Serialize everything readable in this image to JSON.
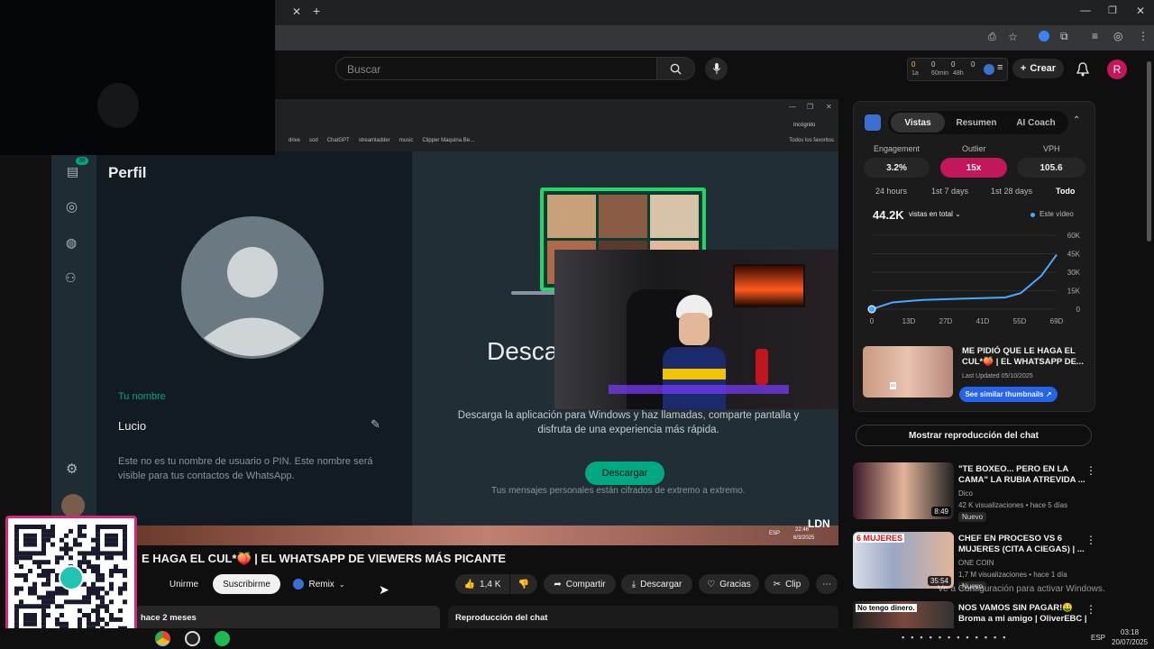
{
  "search": {
    "placeholder": "Buscar"
  },
  "header": {
    "create_label": "Crear",
    "avatar_letter": "R"
  },
  "counters": [
    "0",
    "0",
    "0",
    "0",
    "1a",
    "60min",
    "48h"
  ],
  "whatsapp": {
    "window_title": "Perfil",
    "badge": "38",
    "name_label": "Tu nombre",
    "name_value": "Lucio",
    "name_note": "Este no es tu nombre de usuario o PIN. Este nombre será visible para tus contactos de WhatsApp.",
    "main_title": "Descar",
    "main_desc": "Descarga la aplicación para Windows y haz llamadas, comparte pantalla y disfruta de una experiencia más rápida.",
    "download_label": "Descargar",
    "encrypted_note": "Tus mensajes personales están cifrados de extremo a extremo.",
    "inner_bookmarks": [
      "drive",
      "sod",
      "ChatGPT",
      "streamladder",
      "music",
      "Clipper Maquina Be...",
      "Todos los favoritos"
    ],
    "incognito": "Incógnito",
    "ldn": "LDN",
    "inner_clock": "22:46",
    "inner_date": "6/3/2025",
    "inner_lang": "ESP"
  },
  "video": {
    "title": "E HAGA EL CUL*🍑 | EL WHATSAPP DE VIEWERS MÁS PICANTE",
    "join_label": "Unirme",
    "subscribe_label": "Suscribirme",
    "remix_label": "Remix",
    "likes": "1,4 K",
    "share_label": "Compartir",
    "download_label": "Descargar",
    "thanks_label": "Gracias",
    "clip_label": "Clip",
    "date": "hace 2 meses",
    "chat_replay_header": "Reproducción del chat"
  },
  "stats": {
    "tabs": [
      "Vistas",
      "Resumen",
      "AI Coach"
    ],
    "metrics": [
      {
        "label": "Engagement",
        "value": "3.2%"
      },
      {
        "label": "Outlier",
        "value": "15x"
      },
      {
        "label": "VPH",
        "value": "105.6"
      }
    ],
    "ranges": [
      "24 hours",
      "1st 7 days",
      "1st 28 days",
      "Todo"
    ],
    "total": "44.2K",
    "total_selector": "vistas en total",
    "legend": "Este vídeo",
    "promo_title": "ME PIDIÓ QUE LE HAGA EL CUL*🍑 | EL WHATSAPP DE...",
    "promo_updated": "Last Updated 05/10/2025",
    "promo_button": "See similar thumbnails"
  },
  "chart_data": {
    "type": "line",
    "x": [
      "0",
      "13D",
      "27D",
      "41D",
      "55D",
      "69D"
    ],
    "y_ticks": [
      "60K",
      "45K",
      "30K",
      "15K",
      "0"
    ],
    "ylim": [
      0,
      60000
    ],
    "series": [
      {
        "name": "Este vídeo",
        "values": [
          0,
          5500,
          7500,
          8500,
          9500,
          13000,
          27000,
          44200
        ]
      }
    ],
    "series_x": [
      0,
      8,
      20,
      35,
      52,
      58,
      66,
      72
    ]
  },
  "chat_button": "Mostrar reproducción del chat",
  "recommendations": [
    {
      "title": "\"TE BOXEO... PERO EN LA CAMA\" LA RUBIA ATREVIDA ...",
      "channel": "Dico",
      "meta": "42 K visualizaciones • hace 5 días",
      "badge": "Nuevo",
      "duration": "8:49"
    },
    {
      "title": "CHEF EN PROCESO VS 6 MUJERES (CITA A CIEGAS) | ...",
      "channel": "ONE COIN",
      "meta": "1,7 M visualizaciones • hace 1 día",
      "badge": "Nuevo",
      "duration": "35:54"
    },
    {
      "title": "NOS VAMOS SIN PAGAR!🤑 Broma a mi amigo | OliverEBC |",
      "channel": "",
      "meta": "",
      "badge": "",
      "duration": ""
    }
  ],
  "windows_activation": "Ve a Configuración para activar Windows.",
  "clock": {
    "time": "03:18",
    "date": "20/07/2025",
    "lang": "ESP"
  },
  "colors": {
    "whatsapp_green": "#00a884",
    "accent_pink": "#c2185b",
    "chart_blue": "#4aa8ff"
  }
}
